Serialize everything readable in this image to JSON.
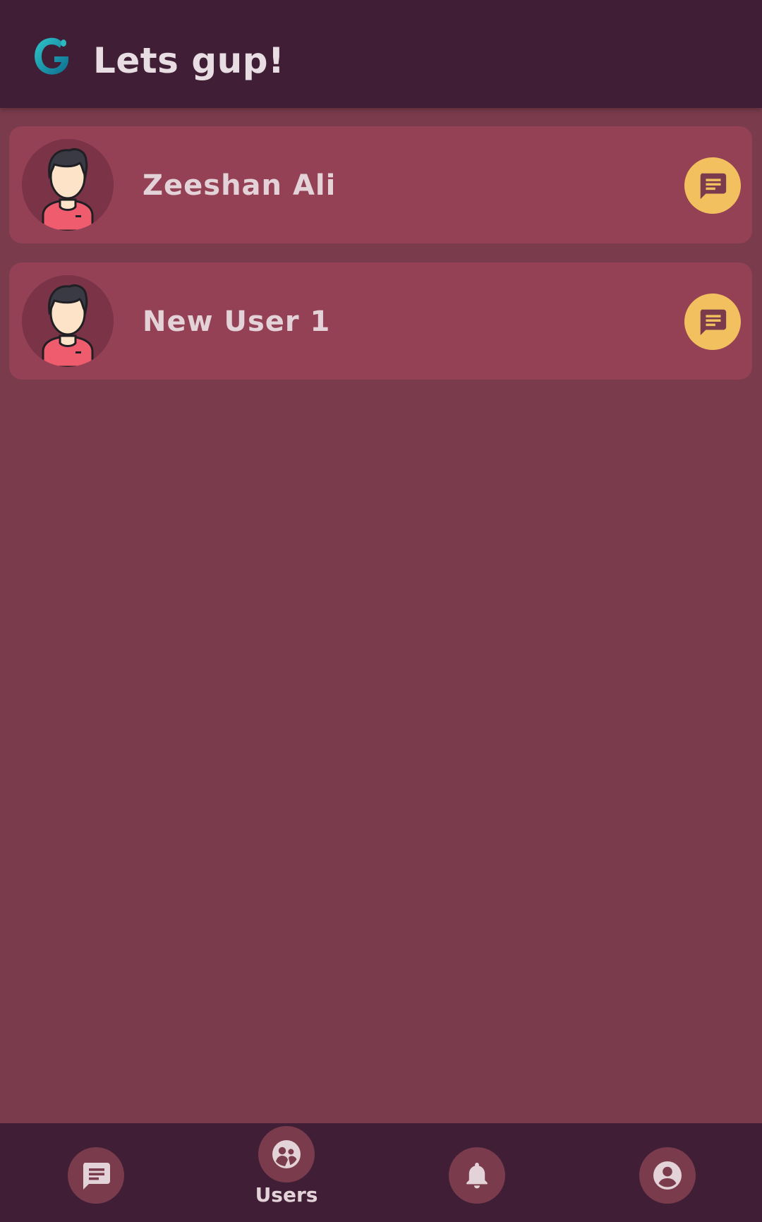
{
  "app_bar": {
    "title": "Lets gup!",
    "logo_icon": "g-logo-icon"
  },
  "users": [
    {
      "name": "Zeeshan Ali",
      "avatar_icon": "male-avatar-icon",
      "action_icon": "chat-icon"
    },
    {
      "name": "New User 1",
      "avatar_icon": "male-avatar-icon",
      "action_icon": "chat-icon"
    }
  ],
  "bottom_nav": {
    "items": [
      {
        "id": "chats",
        "icon": "chat-icon",
        "label": "",
        "active": false
      },
      {
        "id": "users",
        "icon": "users-icon",
        "label": "Users",
        "active": true
      },
      {
        "id": "notifications",
        "icon": "bell-icon",
        "label": "",
        "active": false
      },
      {
        "id": "profile",
        "icon": "account-icon",
        "label": "",
        "active": false
      }
    ]
  },
  "colors": {
    "app_bar": "#401f36",
    "background": "#7a3c4d",
    "card": "#944155",
    "accent": "#f2c05f",
    "text": "#e3d3d8"
  }
}
